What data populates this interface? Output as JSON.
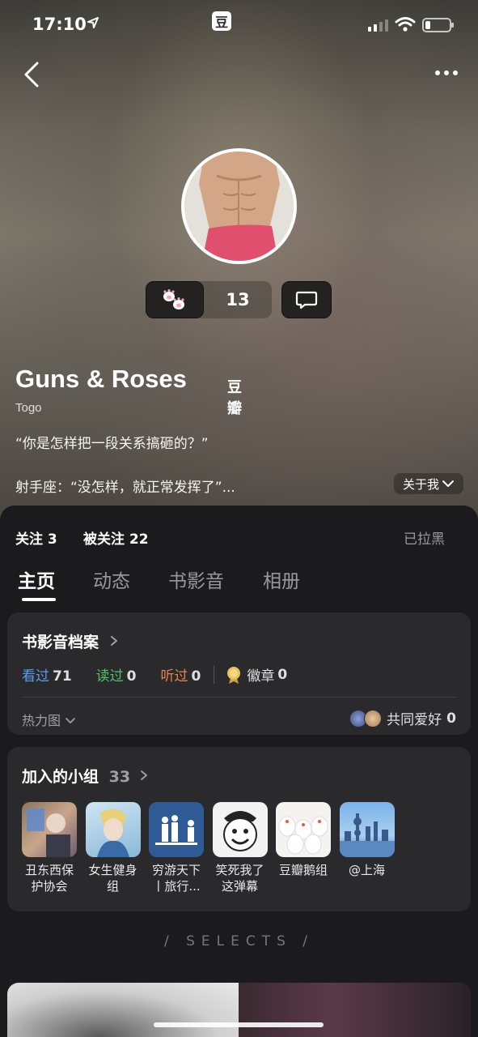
{
  "status_bar": {
    "time": "17:10",
    "app_name": "豆瓣",
    "app_logo_char": "豆"
  },
  "profile": {
    "name": "Guns & Roses",
    "subtitle": "Togo",
    "bio_line1": "“你是怎样把一段关系搞砸的？”",
    "bio_line2": "射手座：“没怎样，就正常发挥了”...",
    "about_label": "关于我",
    "paw_count": "13"
  },
  "follow": {
    "following": "关注 3",
    "followers": "被关注 22",
    "blocked": "已拉黑"
  },
  "tabs": [
    {
      "label": "主页",
      "active": true
    },
    {
      "label": "动态"
    },
    {
      "label": "书影音"
    },
    {
      "label": "相册"
    }
  ],
  "archive": {
    "title": "书影音档案",
    "stats": [
      {
        "label": "看过",
        "value": "71",
        "color": "#5b9cf0"
      },
      {
        "label": "读过",
        "value": "0",
        "color": "#4fc36a"
      },
      {
        "label": "听过",
        "value": "0",
        "color": "#e8844a"
      }
    ],
    "badge": {
      "label": "徽章",
      "value": "0"
    },
    "heatmap_label": "热力图",
    "common_label": "共同爱好",
    "common_value": "0"
  },
  "groups": {
    "title": "加入的小组",
    "count": "33",
    "items": [
      {
        "name": "丑东西保护协会"
      },
      {
        "name": "女生健身组"
      },
      {
        "name": "穷游天下丨旅行..."
      },
      {
        "name": "笑死我了这弹幕"
      },
      {
        "name": "豆瓣鹅组"
      },
      {
        "name": "@上海"
      }
    ]
  },
  "selects_label": "/ SELECTS /"
}
